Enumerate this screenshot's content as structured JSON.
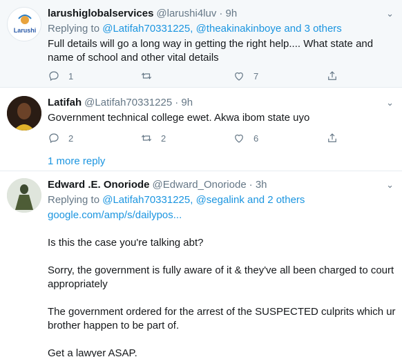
{
  "tweets": [
    {
      "name": "larushiglobalservices",
      "handle": "@larushi4luv",
      "time": "· 9h",
      "avatar_text": "Larushi",
      "replying_prefix": "Replying to",
      "replying_users": [
        "@Latifah70331225",
        "@theakinakinboye"
      ],
      "replying_others": "and 3 others",
      "text": "Full details will go a long way in getting the right help.... What state and name of school and other vital details",
      "reply_count": "1",
      "retweet_count": "",
      "like_count": "7"
    },
    {
      "name": "Latifah",
      "handle": "@Latifah70331225",
      "time": "· 9h",
      "text": "Government technical college ewet. Akwa ibom state uyo",
      "reply_count": "2",
      "retweet_count": "2",
      "like_count": "6",
      "more_replies": "1 more reply"
    },
    {
      "name": "Edward .E. Onoriode",
      "handle": "@Edward_Onoriode",
      "time": "· 3h",
      "replying_prefix": "Replying to",
      "replying_users": [
        "@Latifah70331225",
        "@segalink"
      ],
      "replying_others": "and 2 others",
      "link": "google.com/amp/s/dailypos...",
      "paragraphs": [
        "Is this the case you're talking abt?",
        "Sorry, the government is fully aware of it & they've all been charged to court appropriately",
        "The government ordered for the arrest of the SUSPECTED culprits which ur brother happen to be part of.",
        "Get a lawyer ASAP."
      ]
    }
  ],
  "colors": {
    "link": "#1b95e0",
    "muted": "#657786",
    "highlight_bg": "#f5f8fa"
  },
  "icons": [
    "reply-icon",
    "retweet-icon",
    "like-icon",
    "share-icon",
    "chevron-down-icon"
  ]
}
